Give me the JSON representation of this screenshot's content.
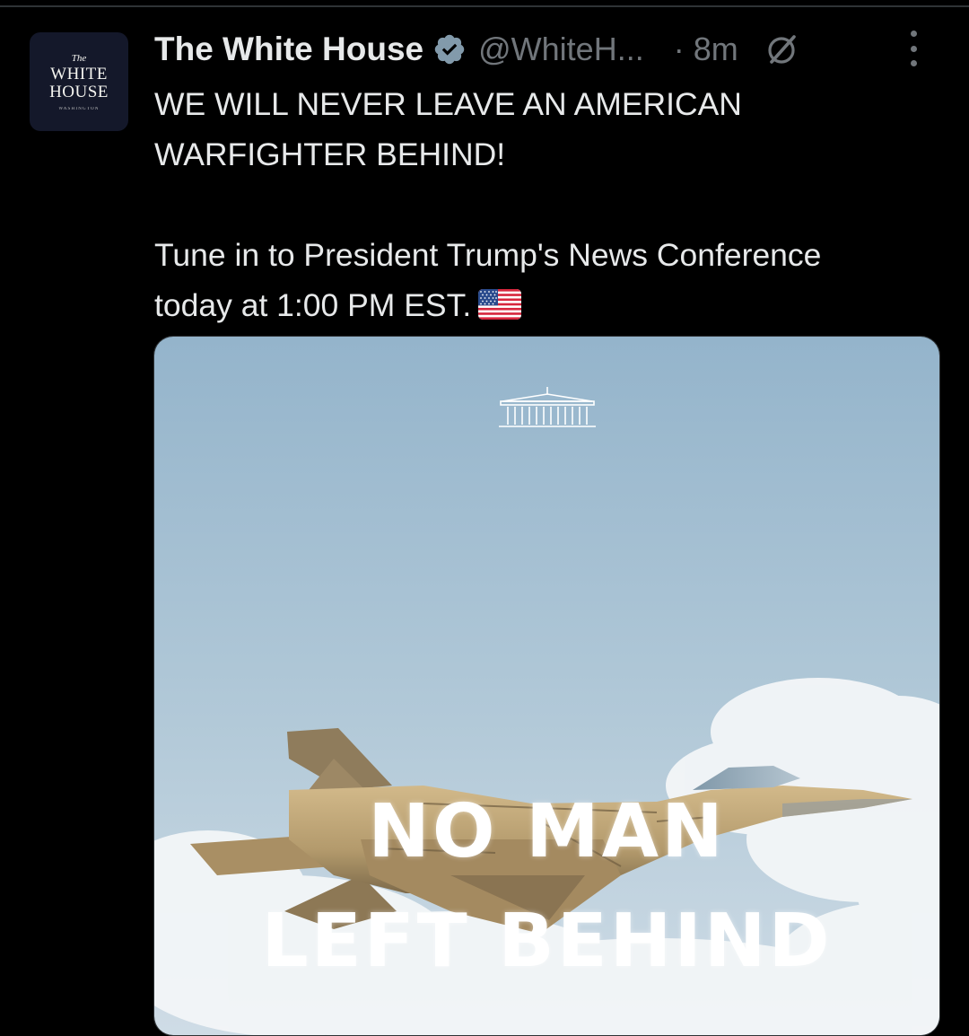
{
  "tweet": {
    "author_name": "The White House",
    "handle": "@WhiteH...",
    "time": "· 8m",
    "avatar": {
      "line_the": "The",
      "line_white": "WHITE",
      "line_house": "HOUSE",
      "line_sub": "WASHINGTON"
    },
    "text_line1": "WE WILL NEVER LEAVE AN AMERICAN",
    "text_line2": "WARFIGHTER BEHIND!",
    "text_line3": "Tune in to President Trump's News Conference",
    "text_line4": "today at 1:00 PM EST.",
    "media": {
      "title_line1": "NO MAN",
      "title_line2": "LEFT BEHIND"
    }
  },
  "icons": [
    "verified-badge-icon",
    "grok-icon",
    "more-options-icon",
    "us-flag-emoji",
    "white-house-logo-icon",
    "fighter-jet-image"
  ],
  "colors": {
    "background": "#000000",
    "text_primary": "#e7e9ea",
    "text_secondary": "#71767b",
    "verified_badge": "#829aab",
    "avatar_bg": "#14182a",
    "sky_top": "#9fbdd3",
    "sky_bottom": "#c4d6e2"
  }
}
